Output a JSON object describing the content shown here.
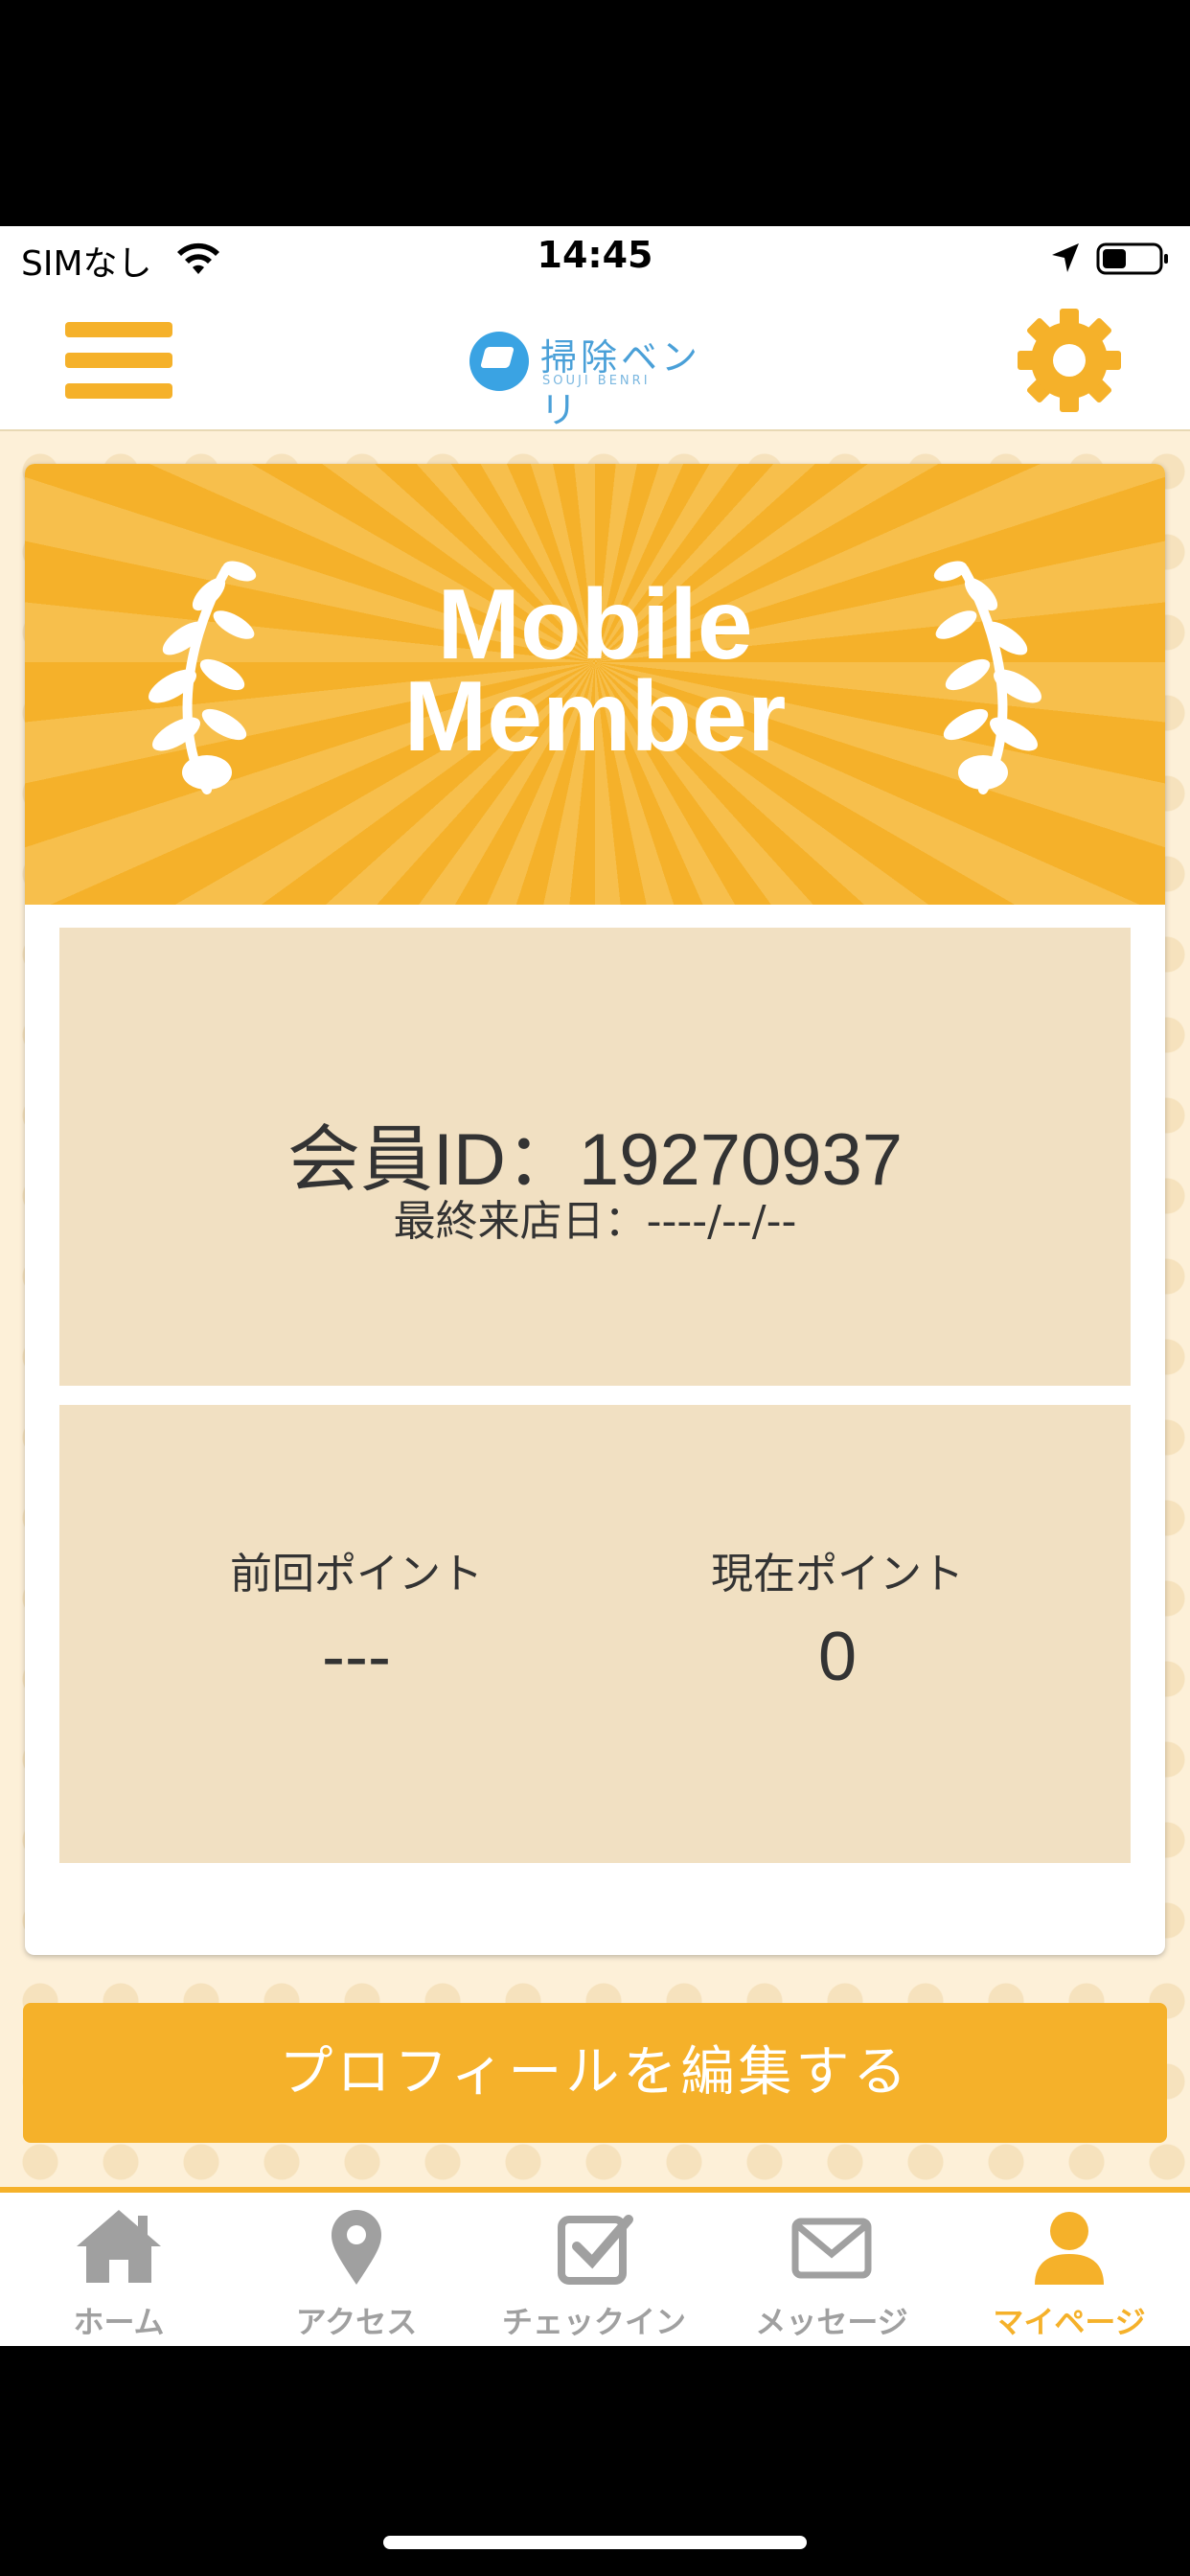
{
  "status_bar": {
    "carrier": "SIMなし",
    "time": "14:45"
  },
  "header": {
    "logo_text": "掃除ベンリ",
    "logo_subtext": "SOUJI BENRI"
  },
  "card": {
    "title_line1": "Mobile",
    "title_line2": "Member",
    "member_id": "会員ID：19270937",
    "last_visit": "最終来店日：----/--/--",
    "previous_points_label": "前回ポイント",
    "previous_points_value": "---",
    "current_points_label": "現在ポイント",
    "current_points_value": "0"
  },
  "edit_profile_label": "プロフィールを編集する",
  "nav": {
    "home": "ホーム",
    "access": "アクセス",
    "checkin": "チェックイン",
    "message": "メッセージ",
    "mypage": "マイページ"
  },
  "colors": {
    "accent": "#f5b12a",
    "panel": "#f1e0c2",
    "inactive": "#a0a0a0"
  }
}
